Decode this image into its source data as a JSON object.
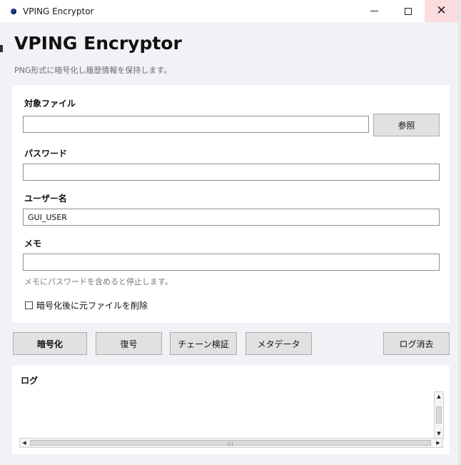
{
  "window": {
    "title": "VPING Encryptor",
    "controls": {
      "minimize": "—",
      "maximize": "☐",
      "close": "✕"
    }
  },
  "header": {
    "title": "VPING Encryptor",
    "subtitle": "PNG形式に暗号化し履歴情報を保持します。"
  },
  "form": {
    "file": {
      "label": "対象ファイル",
      "value": "",
      "placeholder": ""
    },
    "browse_button": "参照",
    "password": {
      "label": "パスワード",
      "value": "",
      "placeholder": ""
    },
    "username": {
      "label": "ユーザー名",
      "value": "GUI_USER",
      "placeholder": ""
    },
    "memo": {
      "label": "メモ",
      "value": "",
      "placeholder": ""
    },
    "memo_hint": "メモにパスワードを含めると停止します。",
    "delete_checkbox": {
      "label": "暗号化後に元ファイルを削除",
      "checked": false
    }
  },
  "actions": {
    "encrypt": "暗号化",
    "decrypt": "復号",
    "verify_chain": "チェーン検証",
    "metadata": "メタデータ",
    "clear_log": "ログ消去"
  },
  "log": {
    "label": "ログ",
    "content": ""
  },
  "icons": {
    "app": "app-icon",
    "scroll_up": "▲",
    "scroll_down": "▼",
    "scroll_left": "◀",
    "scroll_right": "▶"
  }
}
